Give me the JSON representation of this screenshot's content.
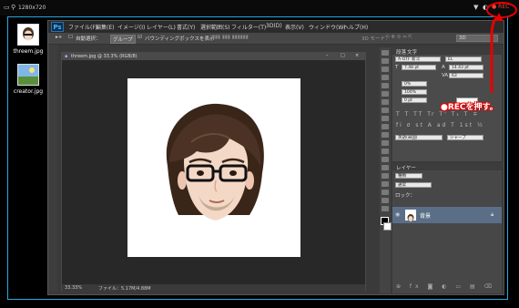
{
  "recorder": {
    "resolution": "1280x720",
    "rec_label": "REC"
  },
  "desktop": {
    "icons": [
      {
        "label": "threem.jpg"
      },
      {
        "label": "creator.jpg"
      }
    ]
  },
  "photoshop": {
    "logo": "Ps",
    "menu": [
      "ファイル(F)",
      "編集(E)",
      "イメージ(I)",
      "レイヤー(L)",
      "書式(Y)",
      "選択範囲(S)",
      "フィルター(T)",
      "3D(D)",
      "表示(V)",
      "ウィンドウ(W)",
      "ヘルプ(H)"
    ],
    "options": {
      "auto_select": "自動選択：",
      "group": "グループ",
      "bounding_box": "バウンディングボックスを表示",
      "mode_3d": "3D モード：",
      "workspace": "3D"
    },
    "document": {
      "title": "threem.jpg @ 33.3% (RGB/8)",
      "zoom": "33.33%",
      "file_info": "ファイル：5.17M/4.88M"
    },
    "character_panel": {
      "tabs": [
        "段落",
        "文字"
      ],
      "font": "A-OTF 新ゴ",
      "style": "EL",
      "size": "7.48 pt",
      "leading": "14.43 pt",
      "tracking": "63",
      "kerning": "0%",
      "scale": "100%",
      "baseline": "0 pt",
      "language": "英語(米国)",
      "antialias": "シャープ"
    },
    "layers_panel": {
      "title": "レイヤー",
      "kind": "種類",
      "blend": "通常",
      "lock": "ロック：",
      "layer_name": "背景"
    }
  },
  "annotation": {
    "text": "●RECを押す。",
    "color": "#e60000"
  }
}
